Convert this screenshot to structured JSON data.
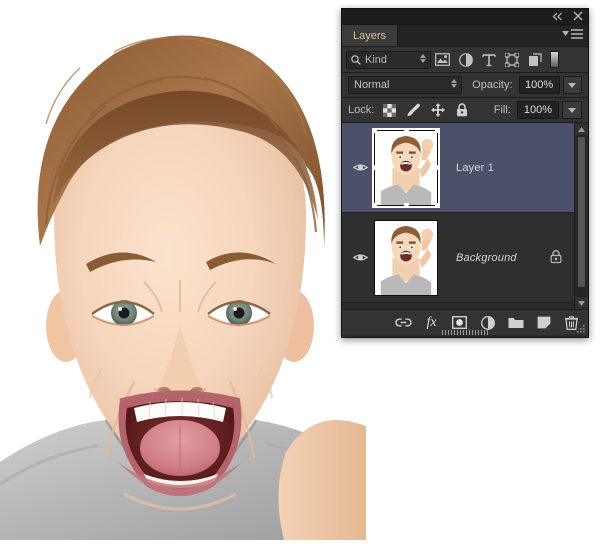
{
  "app": {
    "panel_title": "Layers",
    "titlebar_buttons": [
      {
        "name": "collapse-to-icons",
        "label": "«"
      },
      {
        "name": "close-panel",
        "label": "✕"
      }
    ],
    "panel_menu_label": "Panel menu"
  },
  "filter_row": {
    "kind_label": "Kind",
    "search_icon": "search-icon",
    "filter_icons": [
      {
        "name": "filter-pixel-layers-icon",
        "title": "Pixel layers"
      },
      {
        "name": "filter-adjustment-layers-icon",
        "title": "Adjustment layers"
      },
      {
        "name": "filter-type-layers-icon",
        "title": "Type layers"
      },
      {
        "name": "filter-shape-layers-icon",
        "title": "Shape layers"
      },
      {
        "name": "filter-smart-objects-icon",
        "title": "Smart objects"
      }
    ],
    "filter_toggle": "filter-enable-switch"
  },
  "blend_row": {
    "blend_mode": "Normal",
    "opacity_label": "Opacity:",
    "opacity_value": "100%"
  },
  "lock_row": {
    "lock_label": "Lock:",
    "lock_icons": [
      {
        "name": "lock-transparent-pixels-icon"
      },
      {
        "name": "lock-image-pixels-icon"
      },
      {
        "name": "lock-position-icon"
      },
      {
        "name": "lock-all-icon"
      }
    ],
    "fill_label": "Fill:",
    "fill_value": "100%"
  },
  "layers": [
    {
      "name": "Layer 1",
      "visible": true,
      "selected": true,
      "locked": false,
      "italic": false
    },
    {
      "name": "Background",
      "visible": true,
      "selected": false,
      "locked": true,
      "italic": true
    }
  ],
  "bottom_bar": {
    "buttons": [
      {
        "name": "link-layers-button",
        "label": "Link layers"
      },
      {
        "name": "layer-style-fx-button",
        "label": "fx"
      },
      {
        "name": "add-layer-mask-button",
        "label": "Add layer mask"
      },
      {
        "name": "new-adjustment-layer-button",
        "label": "New fill or adjustment layer"
      },
      {
        "name": "new-group-button",
        "label": "Create a new group"
      },
      {
        "name": "new-layer-button",
        "label": "Create a new layer"
      },
      {
        "name": "delete-layer-button",
        "label": "Delete layer"
      }
    ]
  },
  "colors": {
    "panel_bg": "#2b2b2b",
    "row_bg": "#2f2f2f",
    "selected_row_bg": "#4b5169",
    "tab_text": "#d8c49a",
    "control_bg": "#333333",
    "field_bg": "#232323",
    "text": "#c8c8c8"
  },
  "canvas": {
    "description": "Photograph of a short-haired woman screaming, arm raised, on a white background",
    "background": "#ffffff"
  }
}
